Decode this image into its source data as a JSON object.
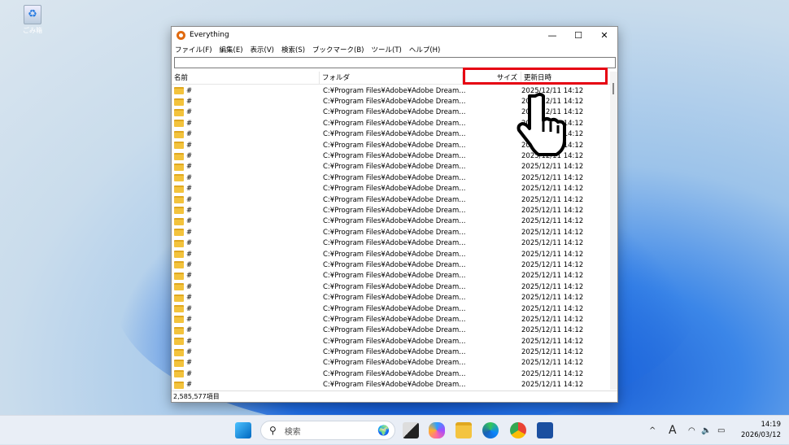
{
  "desktop": {
    "recycle_bin_label": "ごみ箱"
  },
  "window": {
    "title": "Everything",
    "controls": {
      "minimize": "—",
      "maximize": "☐",
      "close": "✕"
    }
  },
  "menu": [
    "ファイル(F)",
    "編集(E)",
    "表示(V)",
    "検索(S)",
    "ブックマーク(B)",
    "ツール(T)",
    "ヘルプ(H)"
  ],
  "search": {
    "value": "",
    "placeholder": ""
  },
  "columns": {
    "name": "名前",
    "folder": "フォルダ",
    "size": "サイズ",
    "modified": "更新日時"
  },
  "rows": [
    {
      "name": "#",
      "folder": "C:¥Program Files¥Adobe¥Adobe Dream...",
      "size": "",
      "modified": "2025/12/11 14:12"
    },
    {
      "name": "#",
      "folder": "C:¥Program Files¥Adobe¥Adobe Dream...",
      "size": "",
      "modified": "2025/12/11 14:12"
    },
    {
      "name": "#",
      "folder": "C:¥Program Files¥Adobe¥Adobe Dream...",
      "size": "",
      "modified": "2025/12/11 14:12"
    },
    {
      "name": "#",
      "folder": "C:¥Program Files¥Adobe¥Adobe Dream...",
      "size": "",
      "modified": "2025/12/11 14:12"
    },
    {
      "name": "#",
      "folder": "C:¥Program Files¥Adobe¥Adobe Dream...",
      "size": "",
      "modified": "2025/12/11 14:12"
    },
    {
      "name": "#",
      "folder": "C:¥Program Files¥Adobe¥Adobe Dream...",
      "size": "",
      "modified": "2025/12/11 14:12"
    },
    {
      "name": "#",
      "folder": "C:¥Program Files¥Adobe¥Adobe Dream...",
      "size": "",
      "modified": "2025/12/11 14:12"
    },
    {
      "name": "#",
      "folder": "C:¥Program Files¥Adobe¥Adobe Dream...",
      "size": "",
      "modified": "2025/12/11 14:12"
    },
    {
      "name": "#",
      "folder": "C:¥Program Files¥Adobe¥Adobe Dream...",
      "size": "",
      "modified": "2025/12/11 14:12"
    },
    {
      "name": "#",
      "folder": "C:¥Program Files¥Adobe¥Adobe Dream...",
      "size": "",
      "modified": "2025/12/11 14:12"
    },
    {
      "name": "#",
      "folder": "C:¥Program Files¥Adobe¥Adobe Dream...",
      "size": "",
      "modified": "2025/12/11 14:12"
    },
    {
      "name": "#",
      "folder": "C:¥Program Files¥Adobe¥Adobe Dream...",
      "size": "",
      "modified": "2025/12/11 14:12"
    },
    {
      "name": "#",
      "folder": "C:¥Program Files¥Adobe¥Adobe Dream...",
      "size": "",
      "modified": "2025/12/11 14:12"
    },
    {
      "name": "#",
      "folder": "C:¥Program Files¥Adobe¥Adobe Dream...",
      "size": "",
      "modified": "2025/12/11 14:12"
    },
    {
      "name": "#",
      "folder": "C:¥Program Files¥Adobe¥Adobe Dream...",
      "size": "",
      "modified": "2025/12/11 14:12"
    },
    {
      "name": "#",
      "folder": "C:¥Program Files¥Adobe¥Adobe Dream...",
      "size": "",
      "modified": "2025/12/11 14:12"
    },
    {
      "name": "#",
      "folder": "C:¥Program Files¥Adobe¥Adobe Dream...",
      "size": "",
      "modified": "2025/12/11 14:12"
    },
    {
      "name": "#",
      "folder": "C:¥Program Files¥Adobe¥Adobe Dream...",
      "size": "",
      "modified": "2025/12/11 14:12"
    },
    {
      "name": "#",
      "folder": "C:¥Program Files¥Adobe¥Adobe Dream...",
      "size": "",
      "modified": "2025/12/11 14:12"
    },
    {
      "name": "#",
      "folder": "C:¥Program Files¥Adobe¥Adobe Dream...",
      "size": "",
      "modified": "2025/12/11 14:12"
    },
    {
      "name": "#",
      "folder": "C:¥Program Files¥Adobe¥Adobe Dream...",
      "size": "",
      "modified": "2025/12/11 14:12"
    },
    {
      "name": "#",
      "folder": "C:¥Program Files¥Adobe¥Adobe Dream...",
      "size": "",
      "modified": "2025/12/11 14:12"
    },
    {
      "name": "#",
      "folder": "C:¥Program Files¥Adobe¥Adobe Dream...",
      "size": "",
      "modified": "2025/12/11 14:12"
    },
    {
      "name": "#",
      "folder": "C:¥Program Files¥Adobe¥Adobe Dream...",
      "size": "",
      "modified": "2025/12/11 14:12"
    },
    {
      "name": "#",
      "folder": "C:¥Program Files¥Adobe¥Adobe Dream...",
      "size": "",
      "modified": "2025/12/11 14:12"
    },
    {
      "name": "#",
      "folder": "C:¥Program Files¥Adobe¥Adobe Dream...",
      "size": "",
      "modified": "2025/12/11 14:12"
    },
    {
      "name": "#",
      "folder": "C:¥Program Files¥Adobe¥Adobe Dream...",
      "size": "",
      "modified": "2025/12/11 14:12"
    },
    {
      "name": "#",
      "folder": "C:¥Program Files¥Adobe¥Adobe Dream...",
      "size": "",
      "modified": "2025/12/11 14:12"
    }
  ],
  "status": {
    "count": "2,585,577項目"
  },
  "highlight_color": "#e60012",
  "taskbar": {
    "search_placeholder": "検索",
    "time": "14:19",
    "date": "2026/03/12",
    "ime": "A",
    "apps": [
      "start-icon",
      "task-view-icon",
      "copilot-icon",
      "file-explorer-icon",
      "edge-icon",
      "chrome-icon",
      "store-icon"
    ]
  }
}
